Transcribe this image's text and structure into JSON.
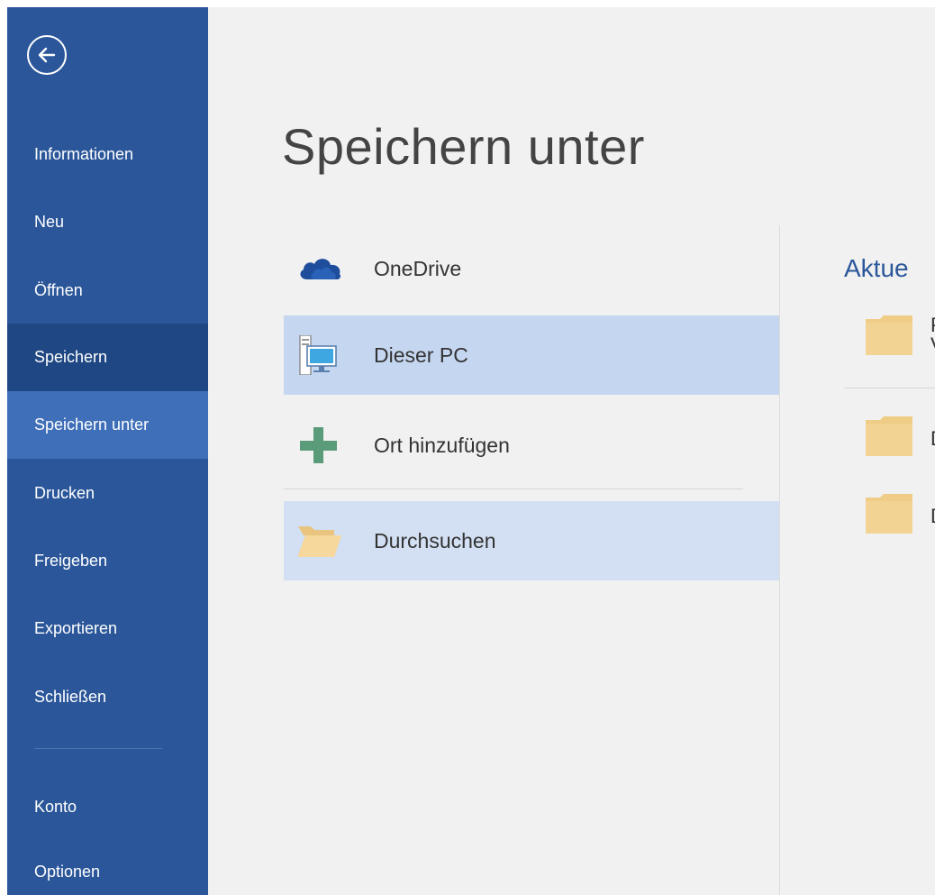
{
  "sidebar": {
    "items": [
      {
        "label": "Informationen"
      },
      {
        "label": "Neu"
      },
      {
        "label": "Öffnen"
      },
      {
        "label": "Speichern"
      },
      {
        "label": "Speichern unter"
      },
      {
        "label": "Drucken"
      },
      {
        "label": "Freigeben"
      },
      {
        "label": "Exportieren"
      },
      {
        "label": "Schließen"
      },
      {
        "label": "Konto"
      },
      {
        "label": "Optionen"
      }
    ],
    "back_icon": "back-arrow-circle-icon",
    "colors": {
      "background": "#2b579a",
      "active": "#1f4783",
      "highlight": "#3f6fb8"
    }
  },
  "main": {
    "title": "Speichern unter",
    "locations": [
      {
        "label": "OneDrive",
        "icon": "onedrive-cloud-icon"
      },
      {
        "label": "Dieser PC",
        "icon": "computer-icon"
      },
      {
        "label": "Ort hinzufügen",
        "icon": "plus-icon"
      },
      {
        "label": "Durchsuchen",
        "icon": "open-folder-icon"
      }
    ]
  },
  "recent": {
    "heading": "Aktue",
    "folders": [
      {
        "line1": "P",
        "line2": "V"
      },
      {
        "line1": "D"
      },
      {
        "line1": "D"
      }
    ]
  }
}
